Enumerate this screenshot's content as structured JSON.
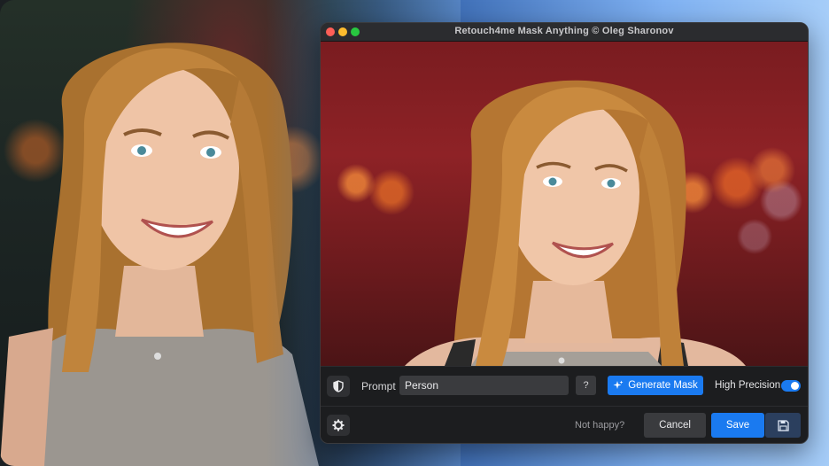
{
  "window": {
    "title": "Retouch4me Mask Anything © Oleg Sharonov"
  },
  "prompt_bar": {
    "mask_icon": "half-shield-icon",
    "prompt_label": "Prompt",
    "prompt_value": "Person",
    "help_label": "?",
    "generate_label": "Generate Mask",
    "generate_icon": "sparkles-icon",
    "high_precision_label": "High Precision",
    "high_precision_on": true
  },
  "bottom_bar": {
    "settings_icon": "gear-icon",
    "not_happy_label": "Not happy?",
    "cancel_label": "Cancel",
    "save_label": "Save",
    "save_to_disk_icon": "floppy-disk-icon"
  },
  "colors": {
    "accent": "#1a7af0",
    "window_bg": "#1e1f21",
    "canvas_bg": "#8e2226"
  }
}
